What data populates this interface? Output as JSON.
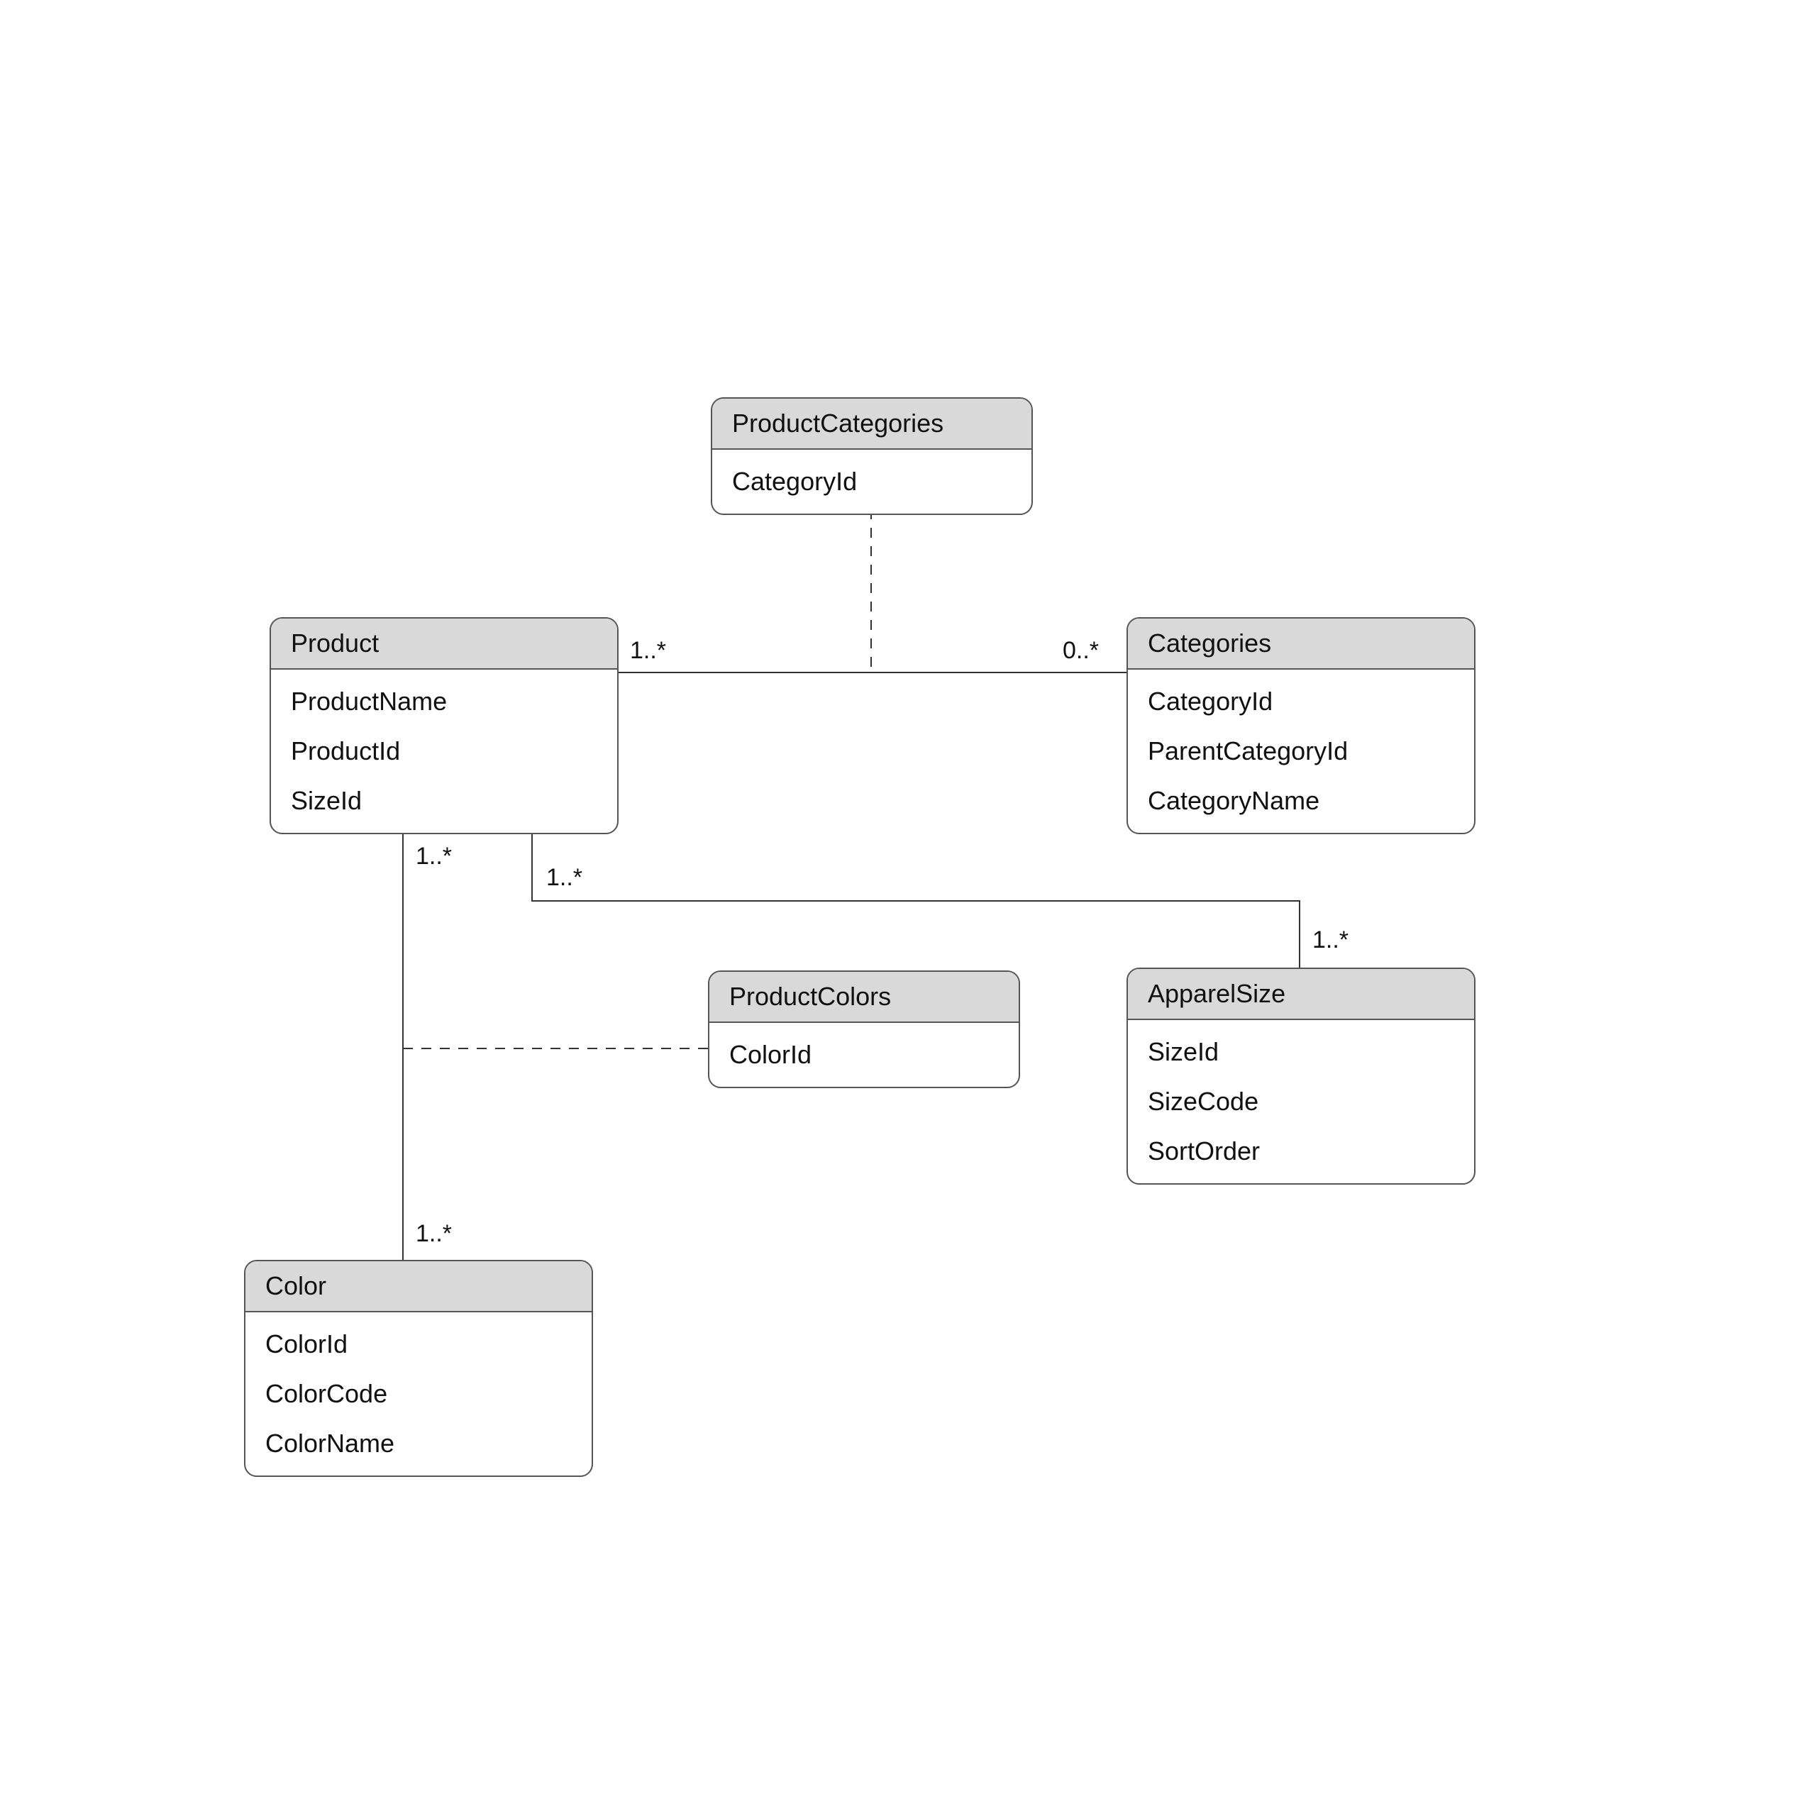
{
  "entities": {
    "productCategories": {
      "title": "ProductCategories",
      "attrs": [
        "CategoryId"
      ]
    },
    "product": {
      "title": "Product",
      "attrs": [
        "ProductName",
        "ProductId",
        "SizeId"
      ]
    },
    "categories": {
      "title": "Categories",
      "attrs": [
        "CategoryId",
        "ParentCategoryId",
        "CategoryName"
      ]
    },
    "productColors": {
      "title": "ProductColors",
      "attrs": [
        "ColorId"
      ]
    },
    "apparelSize": {
      "title": "ApparelSize",
      "attrs": [
        "SizeId",
        "SizeCode",
        "SortOrder"
      ]
    },
    "color": {
      "title": "Color",
      "attrs": [
        "ColorId",
        "ColorCode",
        "ColorName"
      ]
    }
  },
  "multiplicities": {
    "prodToCat_left": "1..*",
    "prodToCat_right": "0..*",
    "prodToColor_top": "1..*",
    "prodToColor_bottom": "1..*",
    "prodToSize_left": "1..*",
    "prodToSize_right": "1..*"
  }
}
